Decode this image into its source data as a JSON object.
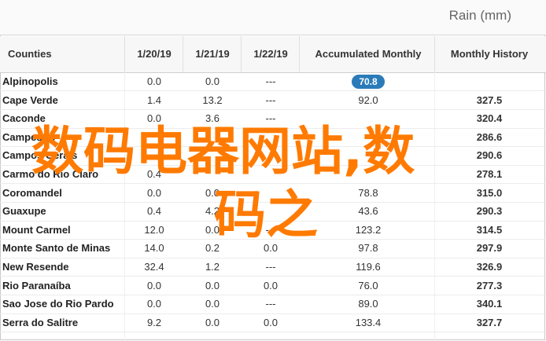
{
  "header_title": "Rain (mm)",
  "columns": [
    "Counties",
    "1/20/19",
    "1/21/19",
    "1/22/19",
    "Accumulated Monthly",
    "Monthly History"
  ],
  "highlight_color": "#2b7bb9",
  "rows": [
    {
      "county": "Alpinopolis",
      "d1": "0.0",
      "d2": "0.0",
      "d3": "---",
      "acc": "70.8",
      "hist": "",
      "highlight": true
    },
    {
      "county": "Cape Verde",
      "d1": "1.4",
      "d2": "13.2",
      "d3": "---",
      "acc": "92.0",
      "hist": "327.5"
    },
    {
      "county": "Caconde",
      "d1": "0.0",
      "d2": "3.6",
      "d3": "---",
      "acc": "",
      "hist": "320.4"
    },
    {
      "county": "Campestre",
      "d1": "",
      "d2": "",
      "d3": "",
      "acc": "",
      "hist": "286.6"
    },
    {
      "county": "Campos Gerais",
      "d1": "",
      "d2": "",
      "d3": "",
      "acc": "",
      "hist": "290.6"
    },
    {
      "county": "Carmo do Rio Claro",
      "d1": "0.4",
      "d2": "",
      "d3": "",
      "acc": "",
      "hist": "278.1"
    },
    {
      "county": "Coromandel",
      "d1": "0.0",
      "d2": "0.0",
      "d3": "",
      "acc": "78.8",
      "hist": "315.0"
    },
    {
      "county": "Guaxupe",
      "d1": "0.4",
      "d2": "4.2",
      "d3": "",
      "acc": "43.6",
      "hist": "290.3"
    },
    {
      "county": "Mount Carmel",
      "d1": "12.0",
      "d2": "0.0",
      "d3": "---",
      "acc": "123.2",
      "hist": "314.5"
    },
    {
      "county": "Monte Santo de Minas",
      "d1": "14.0",
      "d2": "0.2",
      "d3": "0.0",
      "acc": "97.8",
      "hist": "297.9"
    },
    {
      "county": "New Resende",
      "d1": "32.4",
      "d2": "1.2",
      "d3": "---",
      "acc": "119.6",
      "hist": "326.9"
    },
    {
      "county": "Rio Paranaíba",
      "d1": "0.0",
      "d2": "0.0",
      "d3": "0.0",
      "acc": "76.0",
      "hist": "277.3"
    },
    {
      "county": "Sao Jose do Rio Pardo",
      "d1": "0.0",
      "d2": "0.0",
      "d3": "---",
      "acc": "89.0",
      "hist": "340.1"
    },
    {
      "county": "Serra do Salitre",
      "d1": "9.2",
      "d2": "0.0",
      "d3": "0.0",
      "acc": "133.4",
      "hist": "327.7"
    }
  ],
  "watermark": {
    "line1": "数码电器网站,数",
    "line2": "码之",
    "color": "#ff7a00"
  }
}
